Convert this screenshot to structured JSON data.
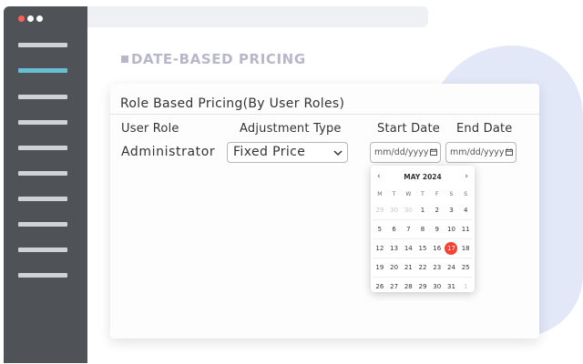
{
  "section_title": "DATE-BASED PRICING",
  "card": {
    "title": "Role Based Pricing(By User Roles)",
    "columns": [
      "User Role",
      "Adjustment Type",
      "Start Date",
      "End Date"
    ],
    "row": {
      "role": "Administrator",
      "adjustment_type": "Fixed Price",
      "start_date_placeholder": "mm/dd/yyyy",
      "end_date_placeholder": "mm/dd/yyyy"
    }
  },
  "calendar": {
    "month": "MAY 2024",
    "prev": "‹",
    "next": "›",
    "weekdays": [
      "M",
      "T",
      "W",
      "T",
      "F",
      "S",
      "S"
    ],
    "weeks": [
      [
        "29",
        "30",
        "30",
        "1",
        "2",
        "3",
        "4"
      ],
      [
        "5",
        "6",
        "7",
        "8",
        "9",
        "10",
        "11"
      ],
      [
        "12",
        "13",
        "14",
        "15",
        "16",
        "17",
        "18"
      ],
      [
        "19",
        "20",
        "21",
        "22",
        "23",
        "24",
        "25"
      ],
      [
        "26",
        "27",
        "28",
        "29",
        "30",
        "31",
        "1"
      ]
    ],
    "selected_day": "17"
  },
  "colors": {
    "sidebar": "#4f5358",
    "sidebar_active": "#66bfd3",
    "accent_today": "#f44336",
    "dots": [
      "#ff5f57",
      "#ffffff",
      "#ffffff"
    ]
  }
}
